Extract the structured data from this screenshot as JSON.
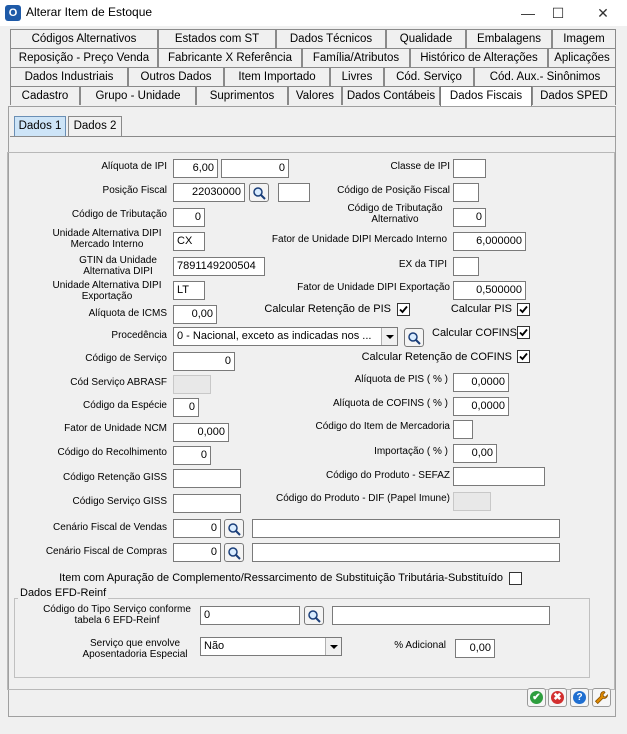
{
  "window": {
    "title": "Alterar Item de Estoque",
    "icon_letter": "O",
    "minimize": "—",
    "maximize": "☐",
    "close": "✕"
  },
  "tabs": {
    "row1": [
      "Códigos Alternativos",
      "Estados com ST",
      "Dados Técnicos",
      "Qualidade",
      "Embalagens",
      "Imagem"
    ],
    "row2": [
      "Reposição - Preço Venda",
      "Fabricante X Referência",
      "Família/Atributos",
      "Histórico de Alterações",
      "Aplicações"
    ],
    "row3": [
      "Dados Industriais",
      "Outros Dados",
      "Item Importado",
      "Livres",
      "Cód. Serviço",
      "Cód. Aux.- Sinônimos"
    ],
    "row4": [
      "Cadastro",
      "Grupo - Unidade",
      "Suprimentos",
      "Valores",
      "Dados Contábeis",
      "Dados Fiscais",
      "Dados SPED"
    ],
    "active": "Dados Fiscais"
  },
  "subtabs": [
    "Dados 1",
    "Dados 2"
  ],
  "form": {
    "aliquota_ipi": {
      "label": "Alíquota de IPI",
      "value": "6,00",
      "value2": "0"
    },
    "classe_ipi": {
      "label": "Classe de IPI",
      "value": ""
    },
    "posicao_fiscal": {
      "label": "Posição Fiscal",
      "value": "22030000",
      "value2": ""
    },
    "codigo_posicao_fiscal": {
      "label": "Código de Posição Fiscal",
      "value": ""
    },
    "codigo_tributacao": {
      "label": "Código de Tributação",
      "value": "0"
    },
    "codigo_tributacao_alt": {
      "label": "Código de Tributação Alternativo",
      "value": "0"
    },
    "unidade_alt_dipi_mi": {
      "label": "Unidade Alternativa DIPI Mercado Interno",
      "value": "CX"
    },
    "fator_unidade_dipi_mi": {
      "label": "Fator de Unidade DIPI Mercado Interno",
      "value": "6,000000"
    },
    "gtin": {
      "label": "GTIN da Unidade Alternativa DIPI",
      "value": "7891149200504"
    },
    "ex_tipi": {
      "label": "EX da TIPI",
      "value": ""
    },
    "unidade_alt_dipi_exp": {
      "label": "Unidade Alternativa DIPI Exportação",
      "value": "LT"
    },
    "fator_unidade_dipi_exp": {
      "label": "Fator de Unidade DIPI Exportação",
      "value": "0,500000"
    },
    "aliquota_icms": {
      "label": "Alíquota de ICMS",
      "value": "0,00"
    },
    "calc_retencao_pis": {
      "label": "Calcular Retenção de PIS",
      "checked": true
    },
    "calc_pis": {
      "label": "Calcular PIS",
      "checked": true
    },
    "procedencia": {
      "label": "Procedência",
      "value": "0 - Nacional, exceto as indicadas nos ..."
    },
    "calc_cofins": {
      "label": "Calcular COFINS",
      "checked": true
    },
    "codigo_servico": {
      "label": "Código de Serviço",
      "value": "0"
    },
    "calc_retencao_cofins": {
      "label": "Calcular Retenção de COFINS",
      "checked": true
    },
    "cod_servico_abrasf": {
      "label": "Cód Serviço ABRASF",
      "value": ""
    },
    "aliquota_pis": {
      "label": "Alíquota de PIS   ( % )",
      "value": "0,0000"
    },
    "codigo_especie": {
      "label": "Código da Espécie",
      "value": "0"
    },
    "aliquota_cofins": {
      "label": "Alíquota de COFINS ( % )",
      "value": "0,0000"
    },
    "fator_unidade_ncm": {
      "label": "Fator de Unidade NCM",
      "value": "0,000"
    },
    "codigo_item_mercadoria": {
      "label": "Código do Item de Mercadoria",
      "value": ""
    },
    "codigo_recolhimento": {
      "label": "Código do Recolhimento",
      "value": "0"
    },
    "importacao": {
      "label": "Importação ( % )",
      "value": "0,00"
    },
    "codigo_retencao_giss": {
      "label": "Código Retenção GISS",
      "value": ""
    },
    "codigo_produto_sefaz": {
      "label": "Código do Produto - SEFAZ",
      "value": ""
    },
    "codigo_servico_giss": {
      "label": "Código Serviço GISS",
      "value": ""
    },
    "codigo_produto_dif": {
      "label": "Código do Produto - DIF (Papel Imune)",
      "value": ""
    },
    "cenario_vendas": {
      "label": "Cenário Fiscal de Vendas",
      "value": "0",
      "desc": ""
    },
    "cenario_compras": {
      "label": "Cenário Fiscal de Compras",
      "value": "0",
      "desc": ""
    },
    "item_apuracao": {
      "label": "Item com Apuração de Complemento/Ressarcimento de Substituição Tributária-Substituído",
      "checked": false
    }
  },
  "efd_reinf": {
    "title": "Dados EFD-Reinf",
    "codigo_tipo_servico": {
      "label": "Código do Tipo Serviço conforme tabela 6 EFD-Reinf",
      "value": "0",
      "desc": ""
    },
    "servico_aposentadoria": {
      "label": "Serviço que envolve Aposentadoria Especial",
      "value": "Não"
    },
    "adicional": {
      "label": "% Adicional",
      "value": "0,00"
    }
  },
  "actions": [
    {
      "name": "confirm-button",
      "icon": "check-icon",
      "color": "#2e9e3e",
      "glyph": "✔"
    },
    {
      "name": "cancel-button",
      "icon": "cancel-icon",
      "color": "#d32f2f",
      "glyph": "✖"
    },
    {
      "name": "help-button",
      "icon": "help-icon",
      "color": "#1f6fd1",
      "glyph": "?"
    },
    {
      "name": "tools-button",
      "icon": "wrench-icon",
      "color": "#e08a00",
      "glyph": "🔧"
    }
  ]
}
